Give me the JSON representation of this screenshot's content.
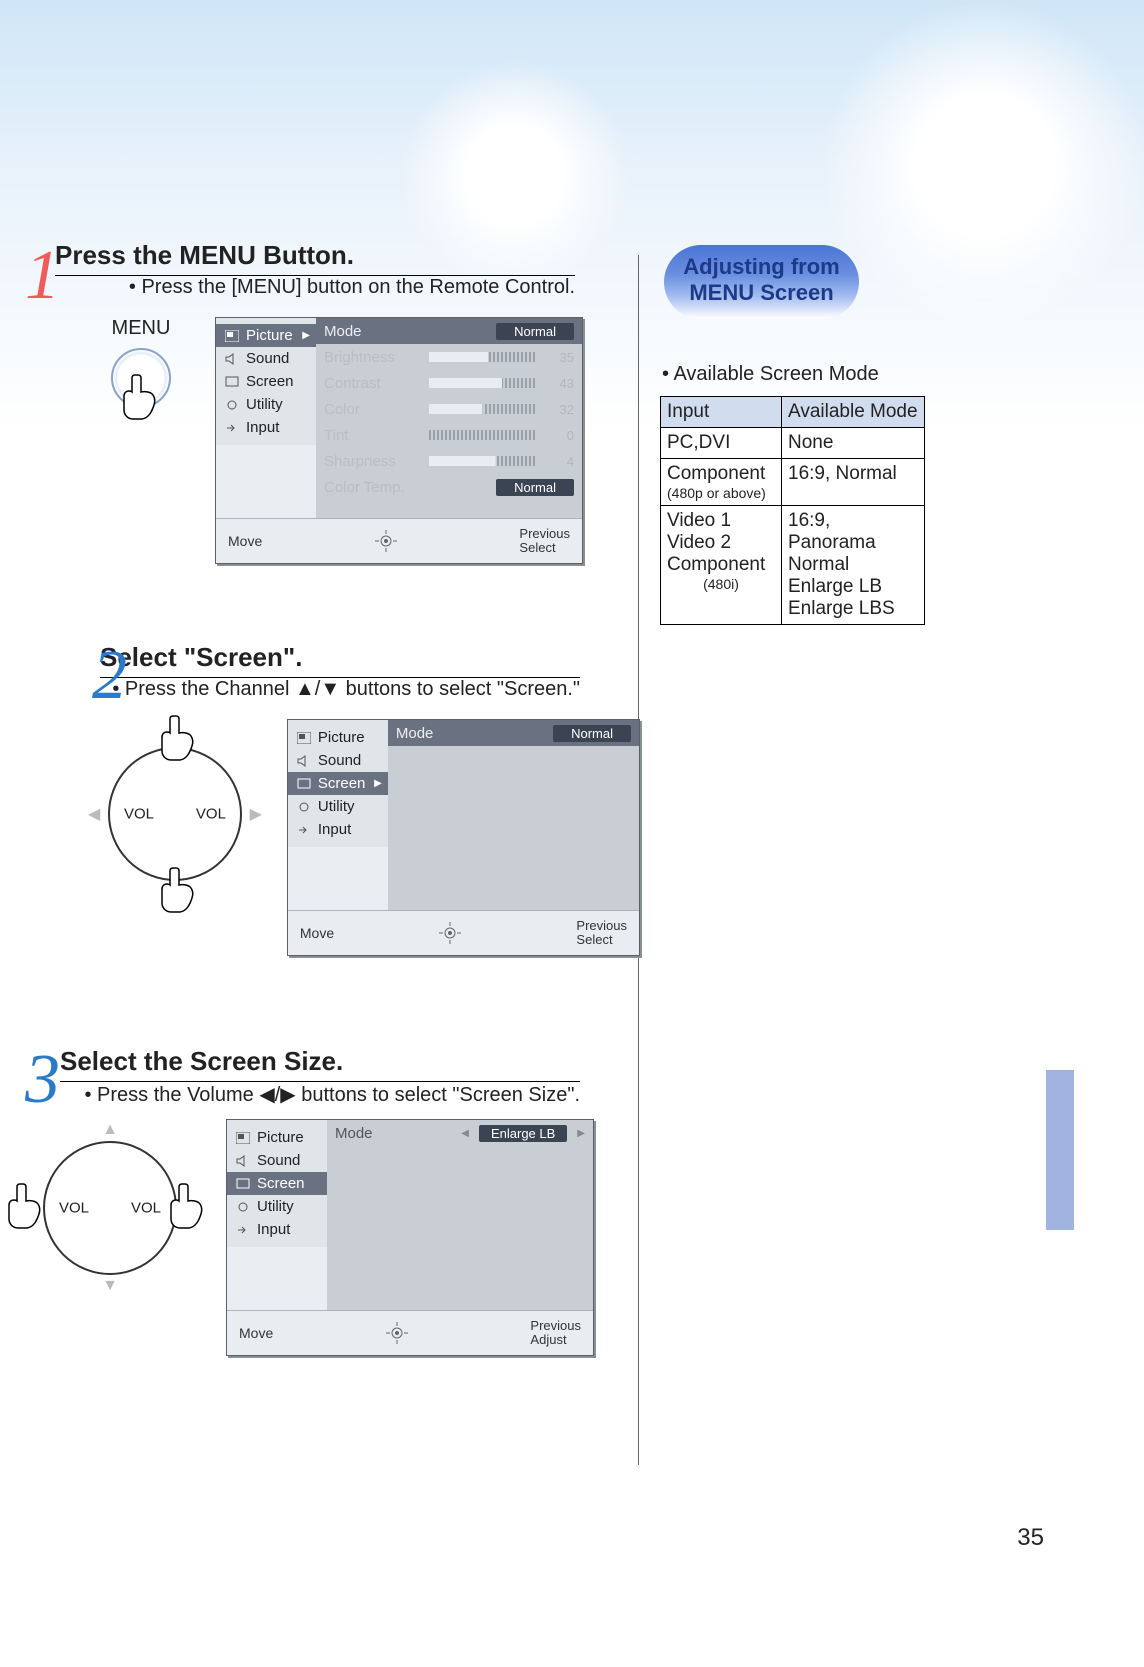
{
  "page_number": "35",
  "steps": {
    "s1": {
      "title": "Press the MENU Button.",
      "bullet": "• Press the [MENU] button on the Remote Control.",
      "remote_label": "MENU"
    },
    "s2": {
      "title": "Select \"Screen\".",
      "bullet": "• Press the Channel ▲/▼ buttons to select \"Screen.\""
    },
    "s3": {
      "title": "Select the Screen Size.",
      "bullet": "• Press the Volume ◀/▶ buttons to select \"Screen Size\"."
    }
  },
  "dpad": {
    "vol_l": "VOL",
    "vol_r": "VOL"
  },
  "osd_common": {
    "menu": {
      "picture": "Picture",
      "sound": "Sound",
      "screen": "Screen",
      "utility": "Utility",
      "input": "Input"
    },
    "footer": {
      "move": "Move",
      "previous": "Previous",
      "select": "Select",
      "adjust": "Adjust"
    }
  },
  "osd1": {
    "rows": {
      "mode": {
        "label": "Mode",
        "value_pill": "Normal"
      },
      "brightness": {
        "label": "Brightness",
        "value": "35",
        "pct": "55%"
      },
      "contrast": {
        "label": "Contrast",
        "value": "43",
        "pct": "68%"
      },
      "color": {
        "label": "Color",
        "value": "32",
        "pct": "50%"
      },
      "tint": {
        "label": "Tint",
        "value": "0",
        "pct": "0%"
      },
      "sharpness": {
        "label": "Sharpness",
        "value": "4",
        "pct": "62%"
      },
      "colortemp": {
        "label": "Color Temp.",
        "value_pill": "Normal"
      }
    }
  },
  "osd2": {
    "mode_label": "Mode",
    "mode_value": "Normal"
  },
  "osd3": {
    "mode_label": "Mode",
    "mode_value": "Enlarge LB"
  },
  "side": {
    "pill_l1": "Adjusting from",
    "pill_l2": "MENU Screen",
    "caption": "• Available Screen Mode",
    "hdr_input": "Input",
    "hdr_mode": "Available Mode",
    "rows": {
      "r1_in": "PC,DVI",
      "r1_m": "None",
      "r2_in_a": "Component",
      "r2_in_b": "(480p or above)",
      "r2_m": "16:9, Normal",
      "r3_in_a": "Video 1",
      "r3_in_b": "Video 2",
      "r3_in_c": "Component",
      "r3_in_d": "(480i)",
      "r3_m_a": "16:9,",
      "r3_m_b": "Panorama",
      "r3_m_c": "Normal",
      "r3_m_d": "Enlarge LB",
      "r3_m_e": "Enlarge LBS"
    }
  }
}
